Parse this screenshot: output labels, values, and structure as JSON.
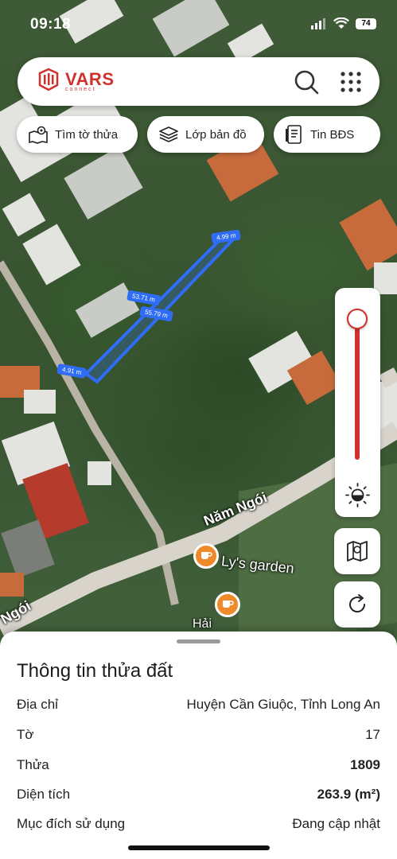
{
  "status_bar": {
    "time": "09:18",
    "battery_level": "74"
  },
  "header": {
    "logo_text": "VARS",
    "logo_sub": "connect",
    "search_icon": "search-icon",
    "apps_icon": "grid-icon"
  },
  "chips": [
    {
      "label": "Tìm tờ thửa",
      "icon": "map-pin-icon"
    },
    {
      "label": "Lớp bản đồ",
      "icon": "layers-icon"
    },
    {
      "label": "Tin BĐS",
      "icon": "document-icon"
    }
  ],
  "measurements": {
    "top_edge": "4.99 m",
    "side_a": "53.71 m",
    "side_b": "55.79 m",
    "bottom_edge": "4.91 m"
  },
  "map_labels": {
    "road": "Năm Ngói",
    "road_left": "Ngói",
    "poi_1": "Ly's garden",
    "poi_2": "Hải"
  },
  "controls": {
    "opacity_level": 0.05
  },
  "parcel_info": {
    "title": "Thông tin thửa đất",
    "rows": [
      {
        "label": "Địa chỉ",
        "value": "Huyện Cần Giuộc, Tỉnh Long An",
        "bold": false
      },
      {
        "label": "Tờ",
        "value": "17",
        "bold": false
      },
      {
        "label": "Thửa",
        "value": "1809",
        "bold": true
      },
      {
        "label": "Diện tích",
        "value": "263.9 (m²)",
        "bold": true
      },
      {
        "label": "Mục đích sử dụng",
        "value": "Đang cập nhật",
        "bold": false
      }
    ]
  },
  "colors": {
    "brand_red": "#d0312d",
    "parcel_blue": "#2f6df6"
  }
}
